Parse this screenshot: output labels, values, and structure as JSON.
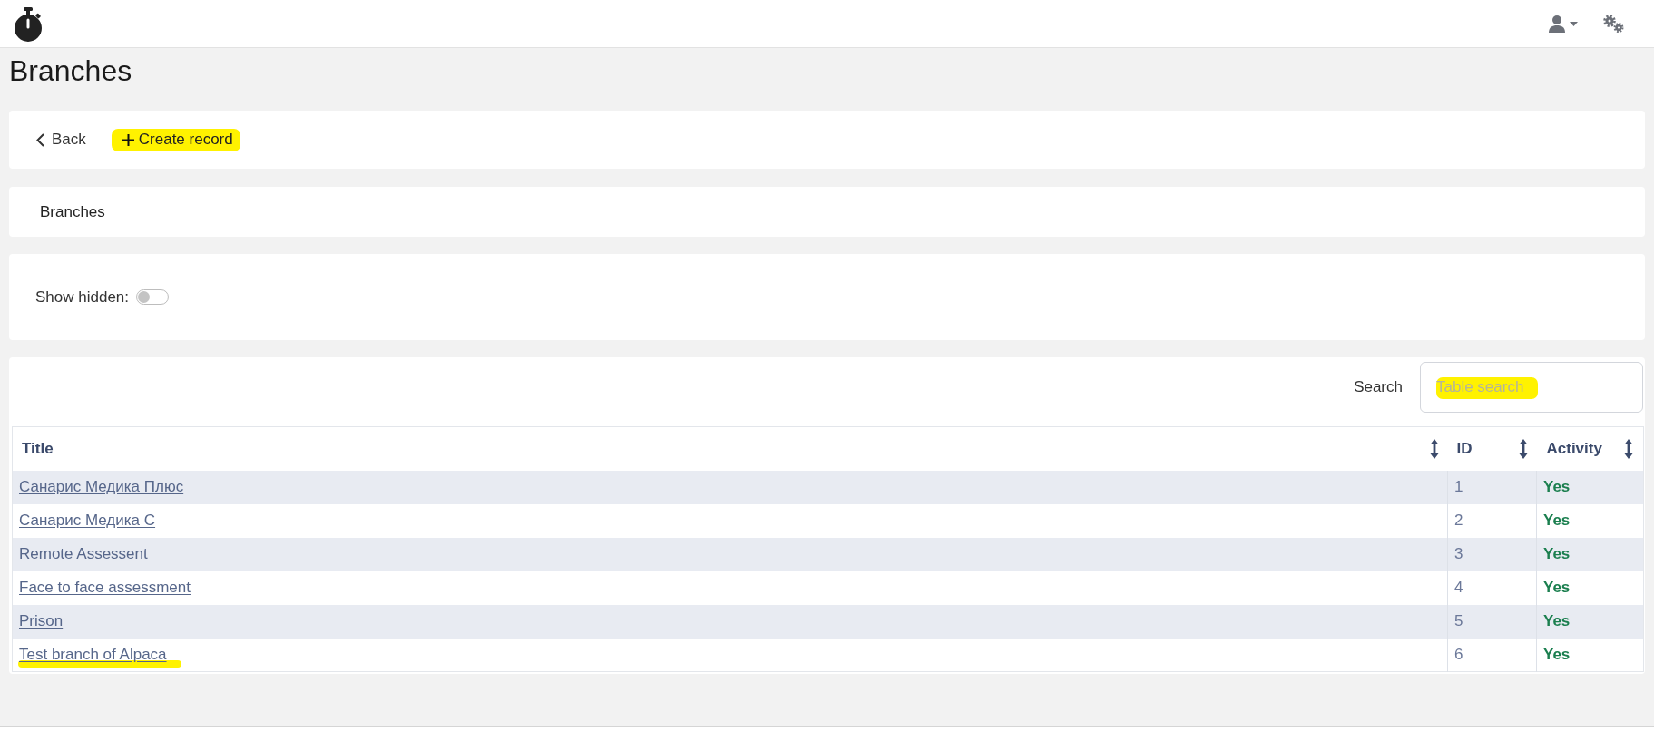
{
  "page_title": "Branches",
  "toolbar": {
    "back": {
      "label": "Back"
    },
    "create": {
      "label": "Create record",
      "highlighted": true
    }
  },
  "panel": {
    "title": "Branches"
  },
  "filters": {
    "show_hidden": {
      "label": "Show hidden:",
      "on": false
    }
  },
  "table": {
    "search": {
      "label": "Search",
      "placeholder": "Table search",
      "highlighted": true
    },
    "columns": [
      {
        "label": "Title"
      },
      {
        "label": "ID"
      },
      {
        "label": "Activity"
      }
    ],
    "rows": [
      {
        "title": "Санарис Медика Плюс",
        "id": "1",
        "activity": "Yes",
        "highlighted": false
      },
      {
        "title": "Санарис Медика С",
        "id": "2",
        "activity": "Yes",
        "highlighted": false
      },
      {
        "title": "Remote Assessent",
        "id": "3",
        "activity": "Yes",
        "highlighted": false
      },
      {
        "title": "Face to face assessment",
        "id": "4",
        "activity": "Yes",
        "highlighted": false
      },
      {
        "title": "Prison",
        "id": "5",
        "activity": "Yes",
        "highlighted": false
      },
      {
        "title": "Test branch of Alpaca",
        "id": "6",
        "activity": "Yes",
        "highlighted": true
      }
    ]
  }
}
